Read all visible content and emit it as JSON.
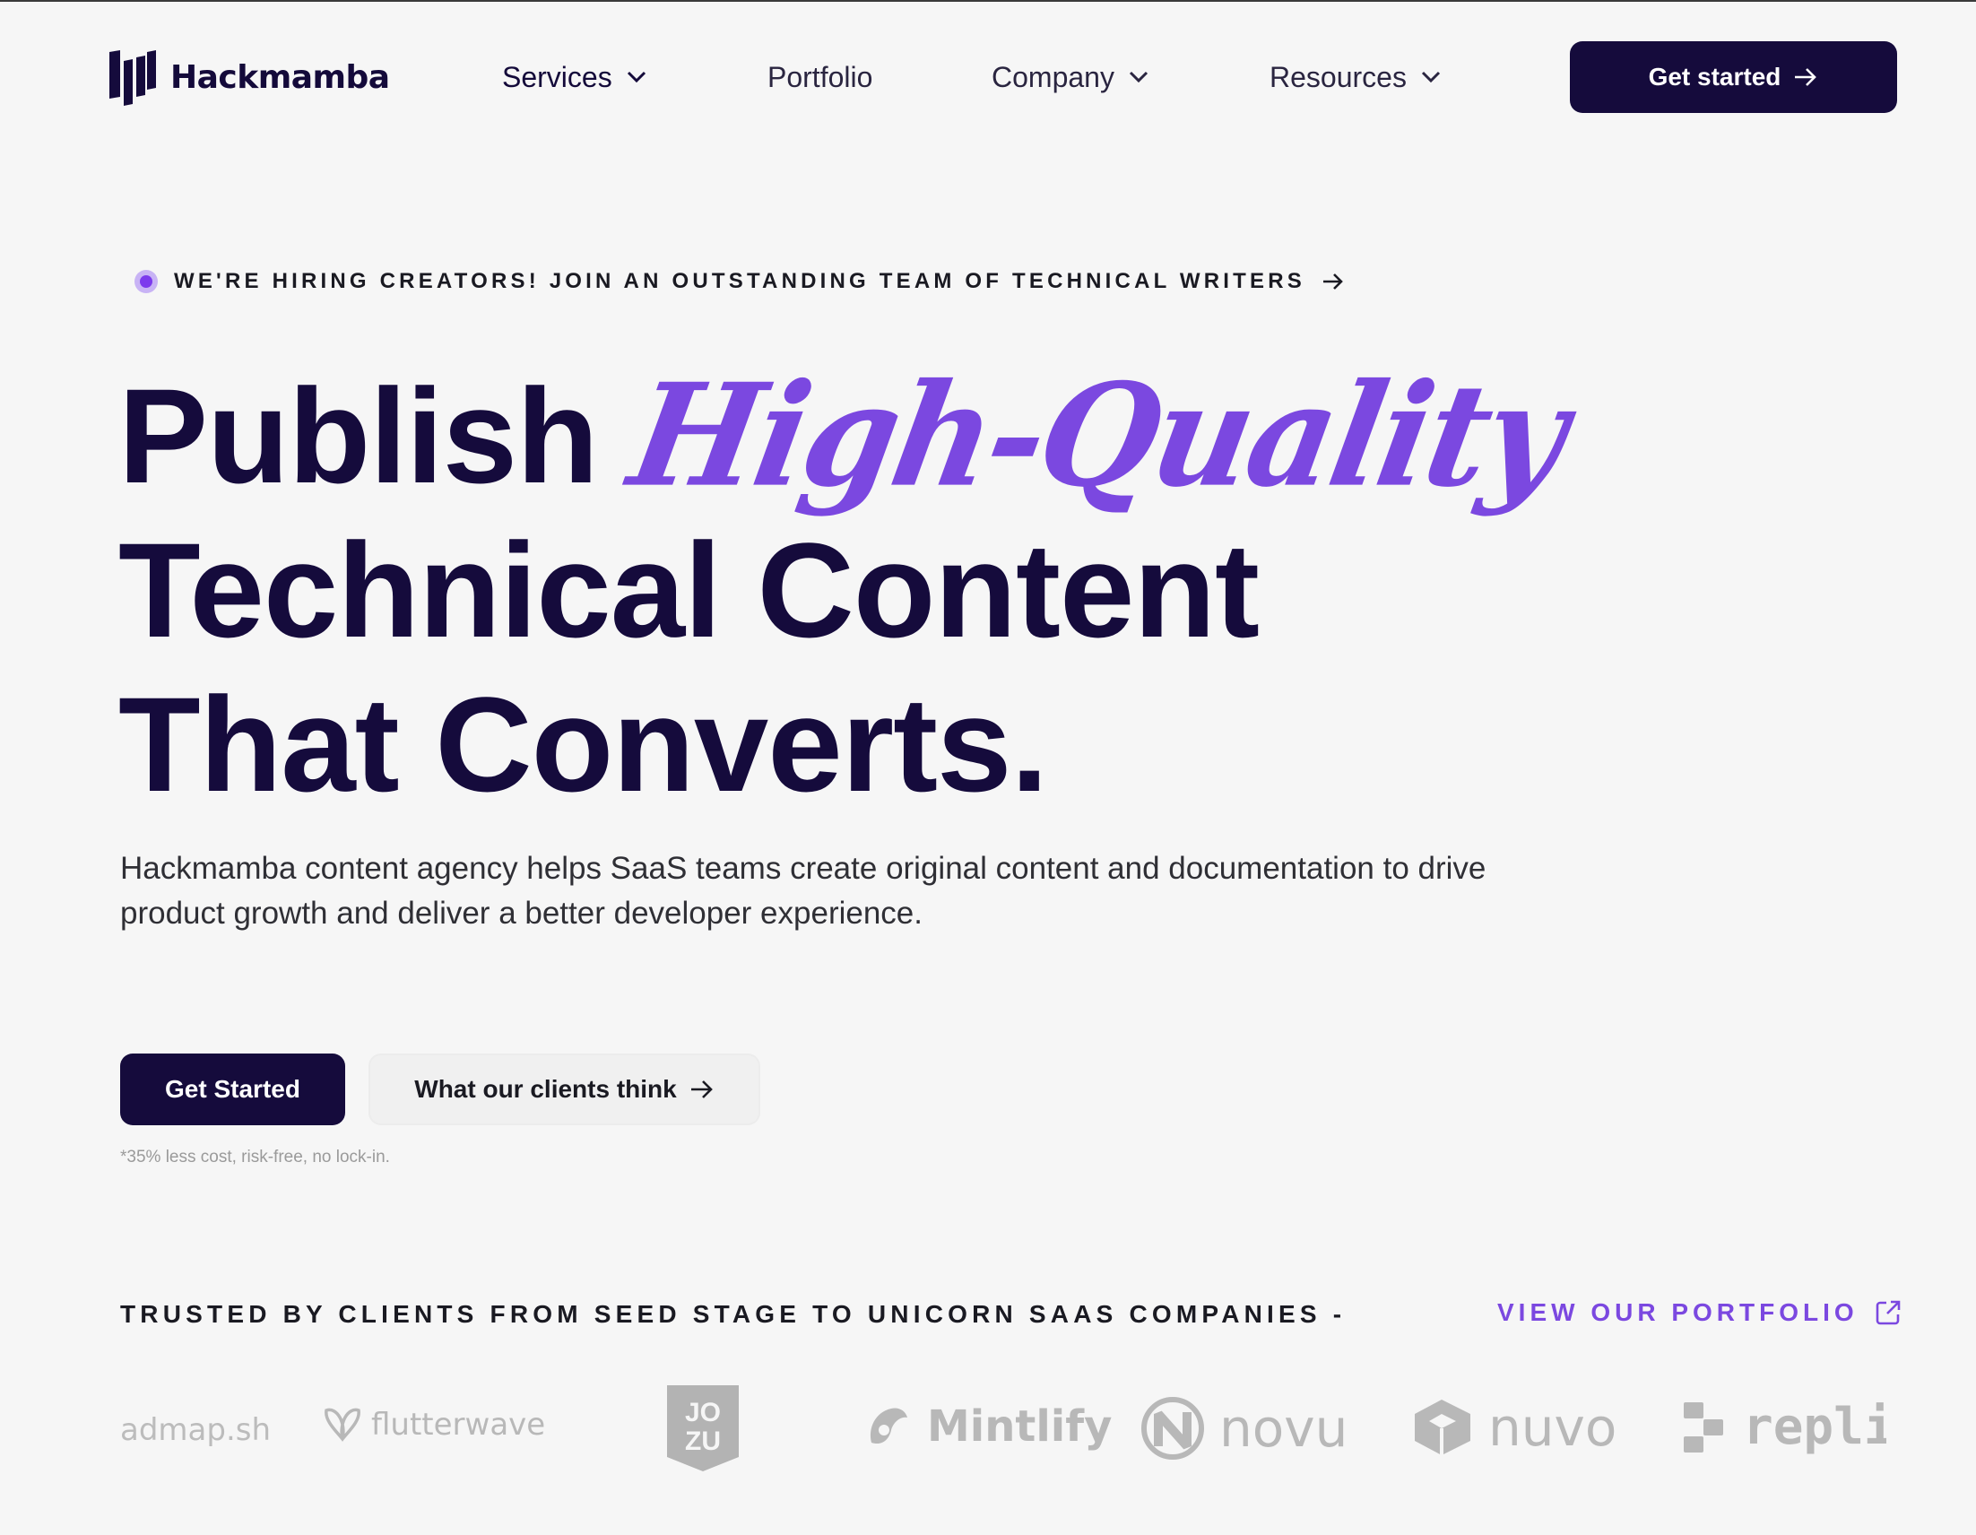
{
  "brand": {
    "name": "Hackmamba"
  },
  "nav": {
    "items": [
      {
        "label": "Services"
      },
      {
        "label": "Portfolio"
      },
      {
        "label": "Company"
      },
      {
        "label": "Resources"
      }
    ],
    "cta_label": "Get started"
  },
  "hiring_banner": {
    "text": "WE'RE HIRING CREATORS!  JOIN AN OUTSTANDING TEAM OF TECHNICAL WRITERS"
  },
  "hero": {
    "line1_word": "Publish",
    "line1_script": "High-Quality",
    "line2": "Technical Content",
    "line3": "That Converts.",
    "subtext": "Hackmamba content agency helps SaaS teams create original content and documentation to drive product growth and deliver a better developer experience.",
    "primary_cta": "Get Started",
    "secondary_cta": "What our clients think",
    "fineprint": "*35% less cost, risk-free, no lock-in."
  },
  "trusted": {
    "heading": "TRUSTED BY CLIENTS FROM SEED STAGE TO UNICORN SAAS COMPANIES -",
    "portfolio_link": "VIEW OUR PORTFOLIO",
    "logos": [
      "admap.sh",
      "flutterwave",
      "JO ZU",
      "Mintlify",
      "novu",
      "nuvo",
      "replit"
    ]
  },
  "colors": {
    "accent": "#7b48e0",
    "primary": "#150b3c",
    "background": "#f6f6f6"
  }
}
